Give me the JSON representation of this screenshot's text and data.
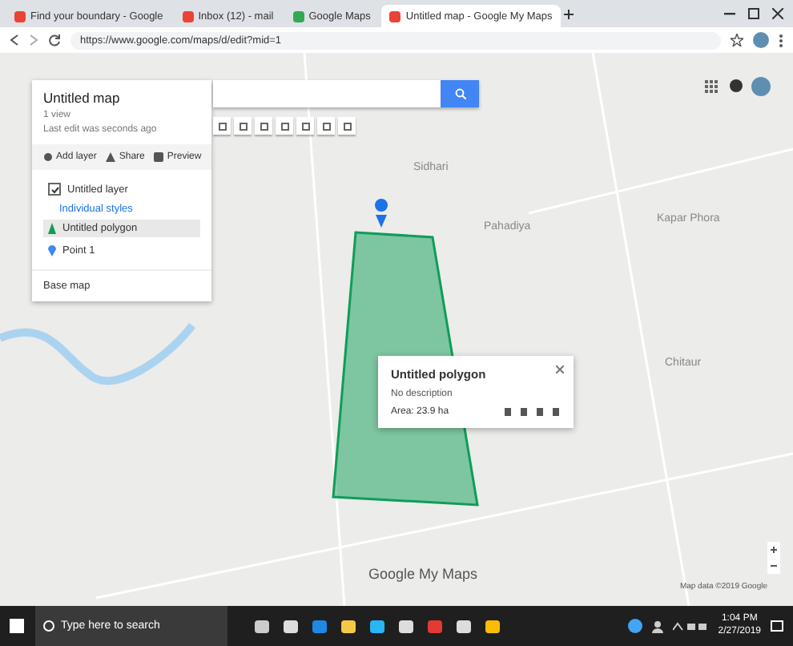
{
  "browser": {
    "tabs": [
      {
        "title": "Find your boundary - Google",
        "selected": false
      },
      {
        "title": "Inbox (12) - mail",
        "selected": false
      },
      {
        "title": "Google Maps",
        "selected": false
      },
      {
        "title": "Untitled map - Google My Maps",
        "selected": true
      }
    ],
    "url": "https://www.google.com/maps/d/edit?mid=1"
  },
  "sidebar": {
    "title": "Untitled map",
    "subtitle": "1 view",
    "description": "Last edit was seconds ago",
    "actions": [
      "Add layer",
      "Share",
      "Preview"
    ],
    "layer": {
      "name": "Untitled layer",
      "checked": true,
      "style": "Individual styles",
      "items": [
        {
          "name": "Untitled polygon",
          "selected": true,
          "color": "#0f9d58"
        },
        {
          "name": "Point 1",
          "selected": false,
          "color": "#4285f4"
        }
      ]
    },
    "base_map": "Base map"
  },
  "map": {
    "labels": [
      "Sidhari",
      "Pahadiya",
      "Kapar Phora",
      "Chitaur"
    ],
    "logo": "Google My Maps",
    "attribution": "Map data ©2019 Google"
  },
  "popup": {
    "title": "Untitled polygon",
    "description": "No description",
    "measurement": "Area: 23.9 ha"
  },
  "taskbar": {
    "search": "Type here to search",
    "time": "1:04 PM",
    "date": "2/27/2019"
  }
}
